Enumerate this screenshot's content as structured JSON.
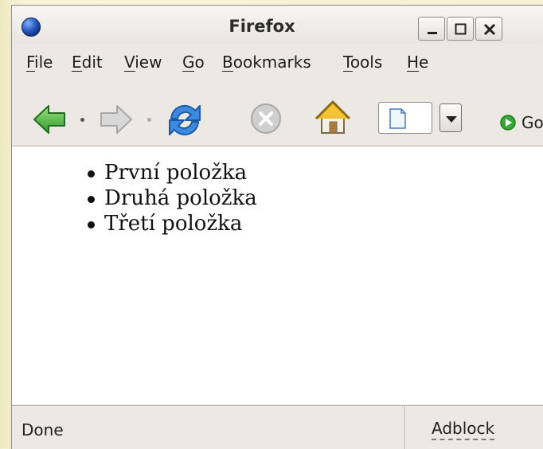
{
  "window": {
    "title": "Firefox"
  },
  "menu": [
    {
      "label": "File"
    },
    {
      "label": "Edit"
    },
    {
      "label": "View"
    },
    {
      "label": "Go"
    },
    {
      "label": "Bookmarks"
    },
    {
      "label": "Tools"
    },
    {
      "label": "He"
    }
  ],
  "toolbar": {
    "go_label": "Go"
  },
  "content": {
    "items": [
      "První položka",
      "Druhá položka",
      "Třetí položka"
    ]
  },
  "status": {
    "text": "Done",
    "addon": "Adblock"
  },
  "colors": {
    "window_bg": "#ece9e4",
    "content_bg": "#ffffff",
    "page_bg": "#f3efc9",
    "back_arrow": "#3eb23e",
    "reload": "#2f7bd6"
  }
}
